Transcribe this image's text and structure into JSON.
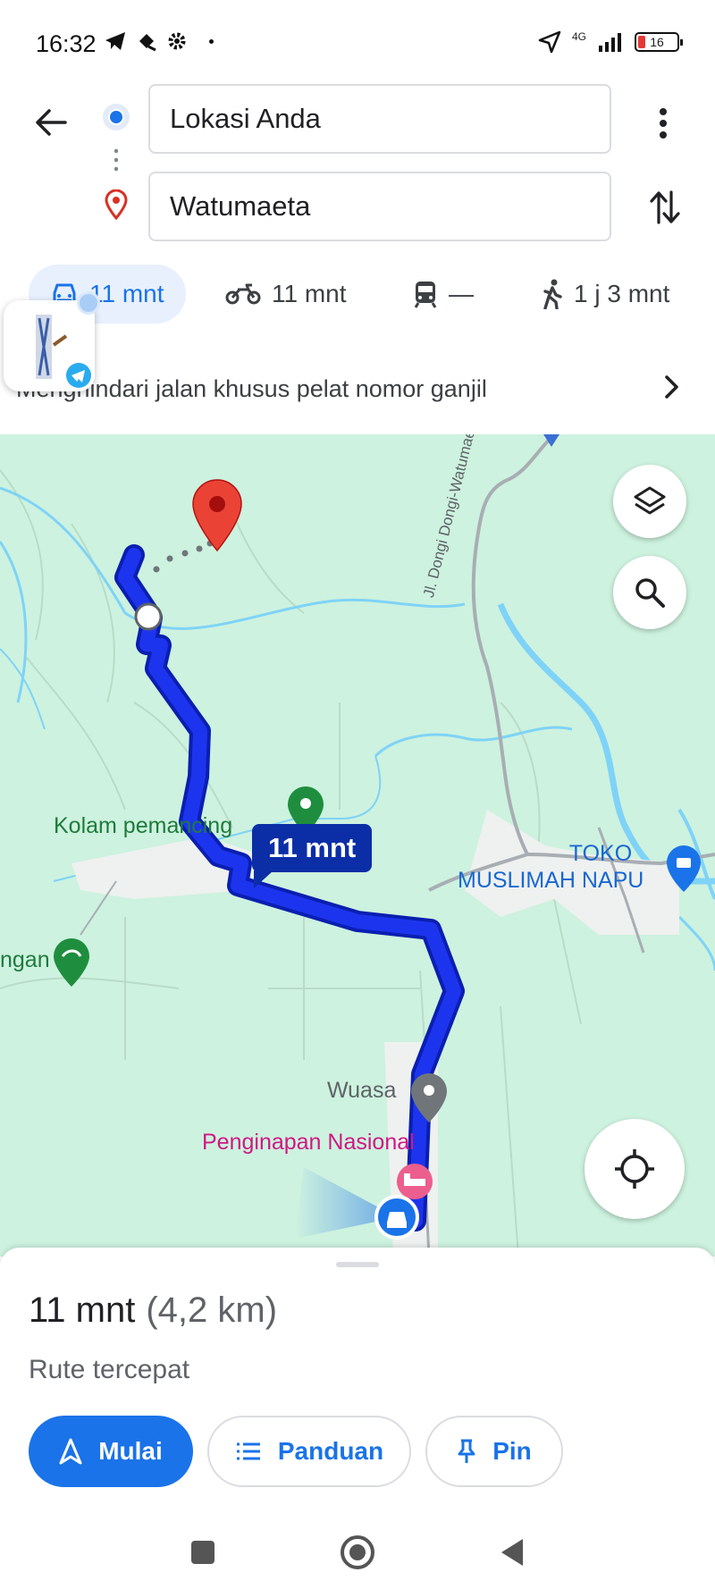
{
  "status_bar": {
    "time": "16:32",
    "network": "4G",
    "battery": "16"
  },
  "directions": {
    "origin": "Lokasi Anda",
    "destination": "Watumaeta"
  },
  "modes": [
    {
      "name": "car",
      "label": "11 mnt",
      "active": true
    },
    {
      "name": "motorcycle",
      "label": "11 mnt",
      "active": false
    },
    {
      "name": "transit",
      "label": "—",
      "active": false
    },
    {
      "name": "walk",
      "label": "1 j 3 mnt",
      "active": false
    }
  ],
  "notice": {
    "text": "Menghindari jalan khusus pelat nomor ganjil"
  },
  "map": {
    "route_time": "11 mnt",
    "labels": {
      "kolam": "Kolam pemancing",
      "toko_line1": "TOKO",
      "toko_line2": "MUSLIMAH NAPU",
      "ngan": "ngan",
      "wuasa": "Wuasa",
      "penginapan": "Penginapan Nasional",
      "road": "Jl. Dongi Dongi-Watumaeta"
    },
    "colors": {
      "land": "#cdf2df",
      "water": "#7fd3f7",
      "route": "#0a22e0",
      "pin": "#ea4335"
    }
  },
  "summary": {
    "duration": "11 mnt",
    "distance": "(4,2 km)",
    "subtitle": "Rute tercepat"
  },
  "actions": {
    "start": "Mulai",
    "guide": "Panduan",
    "pin": "Pin"
  }
}
